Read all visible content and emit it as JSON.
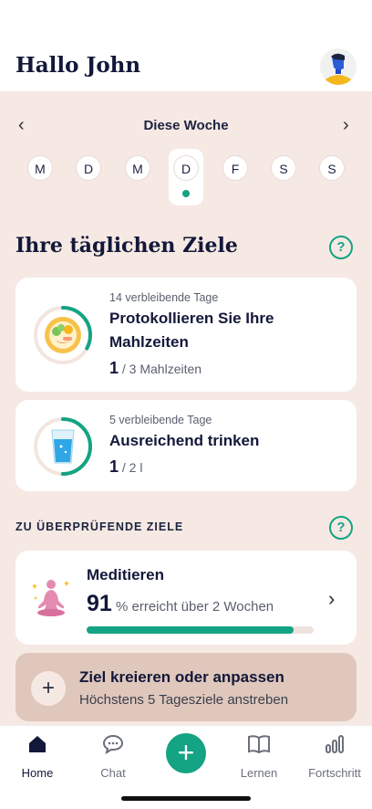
{
  "header": {
    "greeting": "Hallo John"
  },
  "week": {
    "title": "Diese Woche",
    "prev_icon": "chevron-left-icon",
    "next_icon": "chevron-right-icon",
    "days": [
      "M",
      "D",
      "M",
      "D",
      "F",
      "S",
      "S"
    ],
    "selected_index": 3
  },
  "daily_goals": {
    "title": "Ihre täglichen Ziele",
    "help_label": "?",
    "cards": [
      {
        "remaining": "14 verbleibende Tage",
        "title_line1": "Protokollieren Sie Ihre",
        "title_line2": "Mahlzeiten",
        "current": "1",
        "target": " / 3 Mahlzeiten",
        "progress": 0.33,
        "icon": "meal-plate-icon"
      },
      {
        "remaining": "5 verbleibende Tage",
        "title_line1": "Ausreichend trinken",
        "current": "1",
        "target": " / 2 l",
        "progress": 0.5,
        "icon": "water-glass-icon"
      }
    ]
  },
  "review_goals": {
    "label": "ZU ÜBERPRÜFENDE ZIELE",
    "help_label": "?",
    "card": {
      "title": "Meditieren",
      "value": "91",
      "suffix": " % erreicht über 2 Wochen",
      "progress": 0.91,
      "icon": "meditation-icon"
    }
  },
  "create_goal": {
    "title": "Ziel kreieren oder anpassen",
    "subtitle": "Höchstens 5 Tagesziele anstreben",
    "plus": "+"
  },
  "tabs": [
    {
      "label": "Home",
      "icon": "home-icon",
      "active": true
    },
    {
      "label": "Chat",
      "icon": "chat-icon"
    },
    {
      "label": "",
      "icon": "plus-icon"
    },
    {
      "label": "Lernen",
      "icon": "book-icon"
    },
    {
      "label": "Fortschritt",
      "icon": "chart-icon"
    }
  ],
  "colors": {
    "accent": "#14a383",
    "background": "#f6e9e4",
    "create_card": "#dfc7bc",
    "title": "#13183a"
  }
}
